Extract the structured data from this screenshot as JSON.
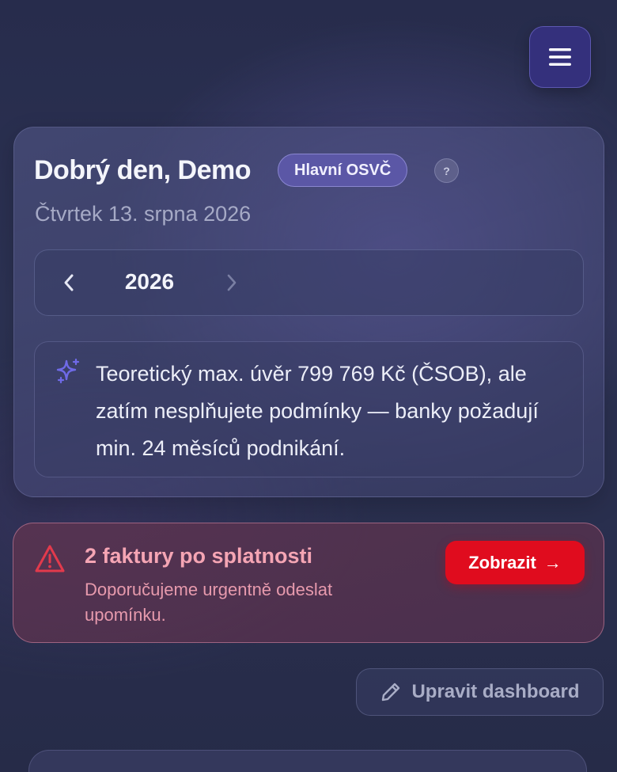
{
  "header": {
    "menu_icon": "hamburger-menu-icon"
  },
  "greeting": {
    "title": "Dobrý den, Demo",
    "role_badge": "Hlavní OSVČ",
    "help_label": "?",
    "date": "Čtvrtek 13. srpna 2026"
  },
  "year_selector": {
    "year": "2026",
    "prev_icon": "chevron-left-icon",
    "next_icon": "chevron-right-icon"
  },
  "insight": {
    "icon": "sparkle-icon",
    "text": "Teoretický max. úvěr 799 769 Kč (ČSOB), ale zatím nesplňujete podmínky — banky požadují min. 24 měsíců podnikání."
  },
  "alert": {
    "icon": "warning-icon",
    "title": "2 faktury po splatnosti",
    "subtitle": "Doporučujeme urgentně odeslat upomínku.",
    "button_label": "Zobrazit",
    "button_arrow": "→"
  },
  "dashboard": {
    "edit_label": "Upravit dashboard",
    "edit_icon": "pencil-icon"
  },
  "colors": {
    "accent": "#34307c",
    "danger": "#e00c1e",
    "alert_text": "#f5a5b4",
    "sparkle": "#6f6ae8"
  }
}
